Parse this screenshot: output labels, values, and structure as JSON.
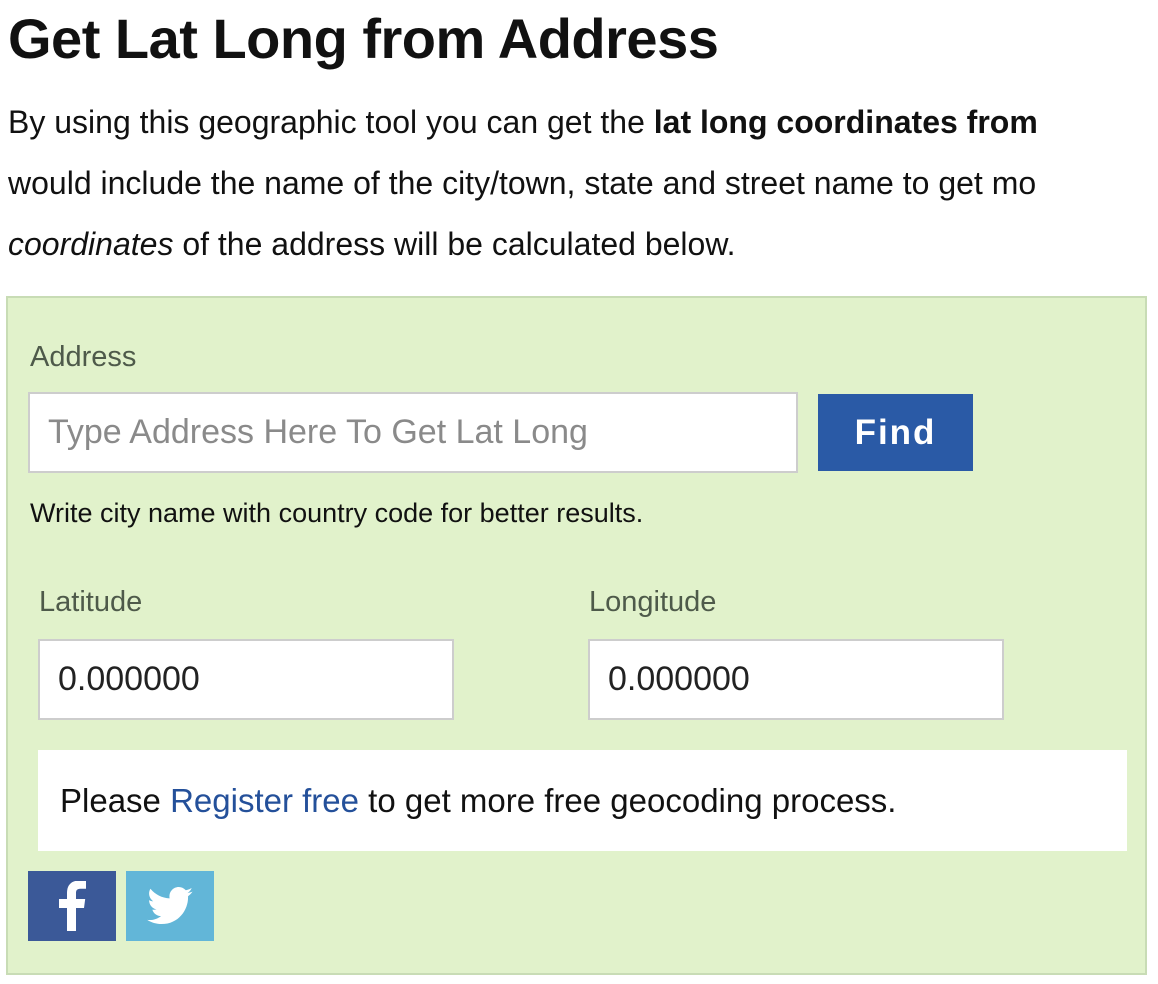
{
  "page": {
    "title": "Get Lat Long from Address",
    "intro": {
      "line1_prefix": "By using this geographic tool you can get the ",
      "line1_bold": "lat long coordinates from",
      "line2": "would include the name of the city/town, state and street name to get mo",
      "line3_italic": "coordinates",
      "line3_rest": " of the address will be calculated below."
    }
  },
  "form": {
    "address_label": "Address",
    "address_placeholder": "Type Address Here To Get Lat Long",
    "address_value": "",
    "find_label": "Find",
    "hint": "Write city name with country code for better results.",
    "latitude_label": "Latitude",
    "latitude_value": "0.000000",
    "longitude_label": "Longitude",
    "longitude_value": "0.000000"
  },
  "notice": {
    "prefix": "Please ",
    "link_text": "Register free",
    "suffix": " to get more free geocoding process."
  },
  "social": {
    "facebook_icon": "facebook-icon",
    "twitter_icon": "twitter-icon"
  },
  "colors": {
    "panel_bg": "#e1f2cb",
    "find_button": "#2a5aa6",
    "link": "#24509a",
    "facebook": "#3b5998",
    "twitter": "#62b6d8"
  }
}
